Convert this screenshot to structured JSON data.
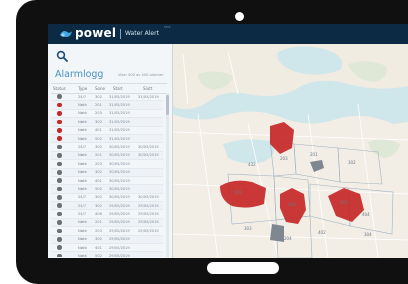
{
  "app": {
    "brand": "powel",
    "name": "Water Alert",
    "tag": "ʰᵃᵃᵇ"
  },
  "panel": {
    "title": "Alarmlogg",
    "count_text": "Viser 400 av 400 alarmer",
    "columns": [
      "Status",
      "Type",
      "Sone",
      "Start",
      "Slutt"
    ]
  },
  "colors": {
    "alarm_active": "#c62828",
    "alarm_closed": "#6b7075",
    "accent": "#4a90c2",
    "header": "#0c2a44"
  },
  "icons": {
    "search": "search-icon",
    "logo": "powel-logo-icon"
  },
  "alarms": [
    {
      "status": "closed",
      "type": "24/7",
      "zone": "302",
      "start": "31/05/2019",
      "end": "31/05/2019"
    },
    {
      "status": "active",
      "type": "Nøkk",
      "zone": "201",
      "start": "31/05/2019",
      "end": ""
    },
    {
      "status": "active",
      "type": "Nøkk",
      "zone": "203",
      "start": "31/05/2019",
      "end": ""
    },
    {
      "status": "active",
      "type": "Nøkk",
      "zone": "302",
      "start": "31/05/2019",
      "end": ""
    },
    {
      "status": "active",
      "type": "Nøkk",
      "zone": "401",
      "start": "31/05/2019",
      "end": ""
    },
    {
      "status": "active",
      "type": "Nøkk",
      "zone": "502",
      "start": "31/05/2019",
      "end": ""
    },
    {
      "status": "closed",
      "type": "24/7",
      "zone": "302",
      "start": "30/05/2019",
      "end": "30/05/2019"
    },
    {
      "status": "closed",
      "type": "Nøkk",
      "zone": "201",
      "start": "30/05/2019",
      "end": "30/05/2019"
    },
    {
      "status": "closed",
      "type": "Nøkk",
      "zone": "203",
      "start": "30/05/2019",
      "end": ""
    },
    {
      "status": "closed",
      "type": "Nøkk",
      "zone": "302",
      "start": "30/05/2019",
      "end": ""
    },
    {
      "status": "closed",
      "type": "Nøkk",
      "zone": "401",
      "start": "30/05/2019",
      "end": ""
    },
    {
      "status": "closed",
      "type": "Nøkk",
      "zone": "502",
      "start": "30/05/2019",
      "end": ""
    },
    {
      "status": "closed",
      "type": "24/7",
      "zone": "302",
      "start": "30/05/2019",
      "end": "30/05/2019"
    },
    {
      "status": "closed",
      "type": "24/7",
      "zone": "302",
      "start": "29/05/2019",
      "end": "29/05/2019"
    },
    {
      "status": "closed",
      "type": "24/7",
      "zone": "406",
      "start": "29/05/2019",
      "end": "29/05/2019"
    },
    {
      "status": "closed",
      "type": "Nøkk",
      "zone": "201",
      "start": "29/05/2019",
      "end": "29/05/2019"
    },
    {
      "status": "closed",
      "type": "Nøkk",
      "zone": "203",
      "start": "29/05/2019",
      "end": "29/05/2019"
    },
    {
      "status": "closed",
      "type": "Nøkk",
      "zone": "302",
      "start": "29/05/2019",
      "end": ""
    },
    {
      "status": "closed",
      "type": "Nøkk",
      "zone": "401",
      "start": "29/05/2019",
      "end": ""
    },
    {
      "status": "closed",
      "type": "Nøkk",
      "zone": "502",
      "start": "29/05/2019",
      "end": ""
    },
    {
      "status": "closed",
      "type": "Nøkk",
      "zone": "201",
      "start": "28/05/2019",
      "end": ""
    },
    {
      "status": "closed",
      "type": "Nøkk",
      "zone": "203",
      "start": "28/05/2019",
      "end": ""
    }
  ],
  "map": {
    "zones": [
      "501",
      "432",
      "406",
      "401",
      "302",
      "201",
      "203",
      "404",
      "303",
      "204",
      "402",
      "304"
    ]
  }
}
